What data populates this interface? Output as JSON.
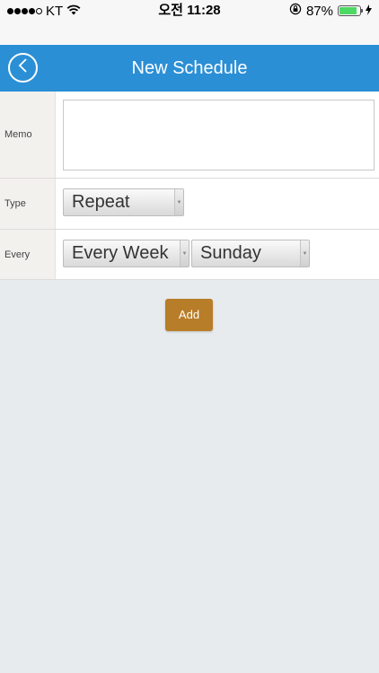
{
  "status_bar": {
    "carrier": "KT",
    "time": "오전 11:28",
    "battery_percent": "87%",
    "battery_level": 0.87,
    "battery_color": "#4cd964",
    "icons": [
      "signal-dots-icon",
      "wifi-icon",
      "orientation-lock-icon",
      "battery-icon",
      "charging-bolt-icon"
    ]
  },
  "nav": {
    "title": "New Schedule",
    "back_icon": "back-chevron-icon",
    "color": "#2b8fd6"
  },
  "form": {
    "memo": {
      "label": "Memo",
      "value": ""
    },
    "type": {
      "label": "Type",
      "selected": "Repeat"
    },
    "every": {
      "label": "Every",
      "period_selected": "Every Week",
      "day_selected": "Sunday"
    }
  },
  "actions": {
    "add_label": "Add",
    "add_color": "#b87d28"
  }
}
